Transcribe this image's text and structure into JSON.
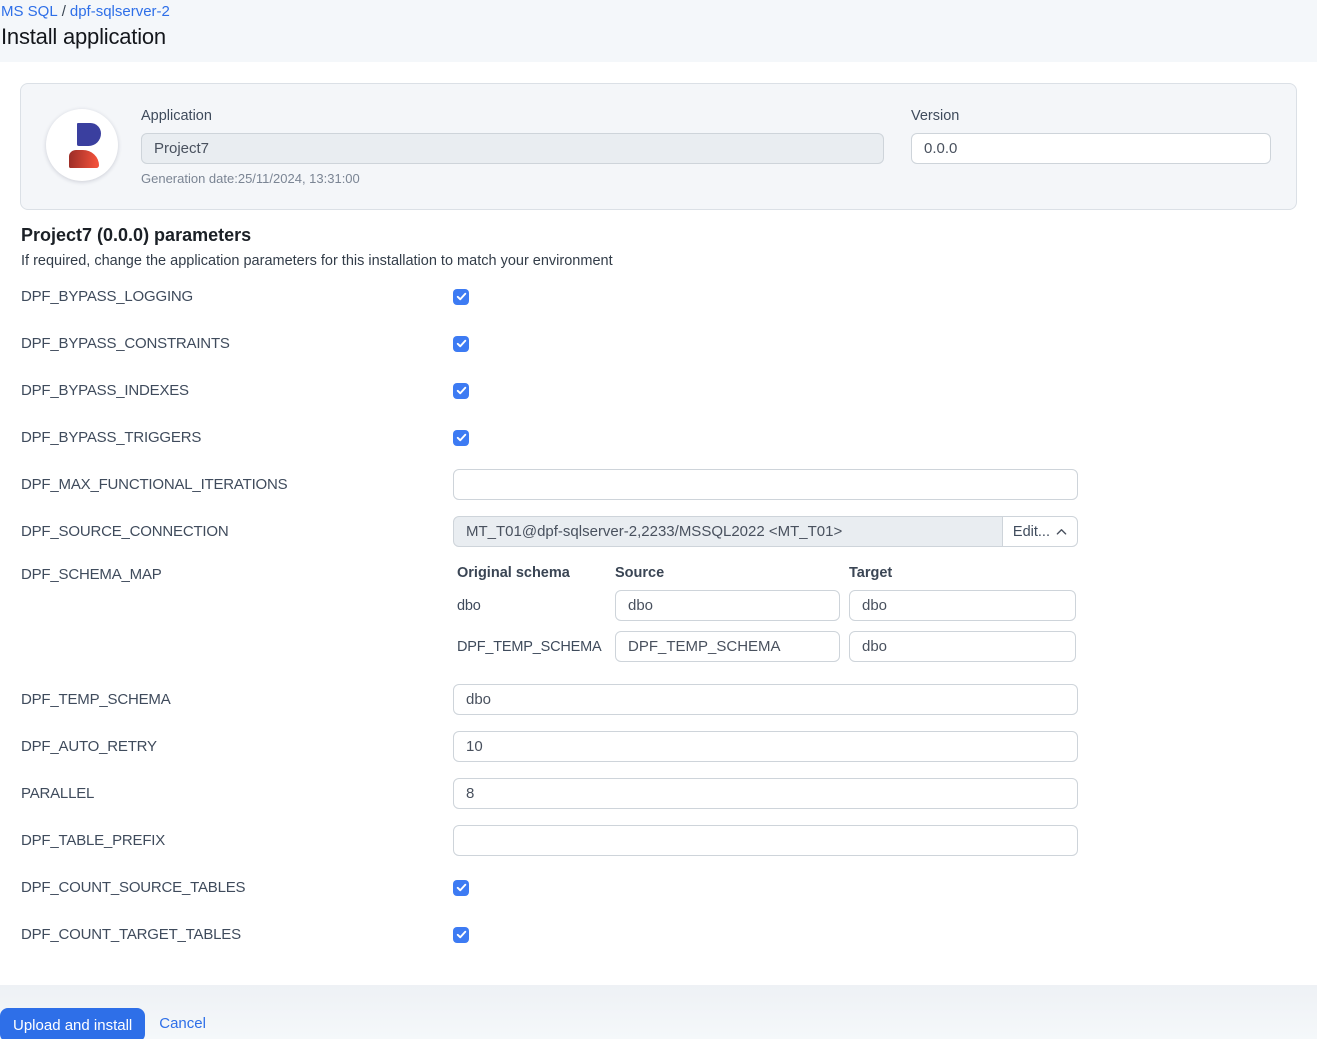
{
  "breadcrumb": {
    "items": [
      {
        "label": "MS SQL"
      },
      {
        "label": "dpf-sqlserver-2"
      }
    ],
    "separator": "/"
  },
  "page_title": "Install application",
  "app_card": {
    "application_label": "Application",
    "application_value": "Project7",
    "generation_date": "Generation date:25/11/2024, 13:31:00",
    "version_label": "Version",
    "version_value": "0.0.0"
  },
  "parameters": {
    "title": "Project7 (0.0.0) parameters",
    "subtitle": "If required, change the application parameters for this installation to match your environment",
    "rows": [
      {
        "type": "checkbox",
        "label": "DPF_BYPASS_LOGGING",
        "checked": true
      },
      {
        "type": "checkbox",
        "label": "DPF_BYPASS_CONSTRAINTS",
        "checked": true
      },
      {
        "type": "checkbox",
        "label": "DPF_BYPASS_INDEXES",
        "checked": true
      },
      {
        "type": "checkbox",
        "label": "DPF_BYPASS_TRIGGERS",
        "checked": true
      },
      {
        "type": "text",
        "label": "DPF_MAX_FUNCTIONAL_ITERATIONS",
        "value": ""
      },
      {
        "type": "connection",
        "label": "DPF_SOURCE_CONNECTION",
        "value": "MT_T01@dpf-sqlserver-2,2233/MSSQL2022 <MT_T01>",
        "button_label": "Edit...",
        "chevron": "up"
      },
      {
        "type": "schema_map",
        "label": "DPF_SCHEMA_MAP",
        "headers": [
          "Original schema",
          "Source",
          "Target"
        ],
        "map_rows": [
          {
            "original": "dbo",
            "source": "dbo",
            "target": "dbo"
          },
          {
            "original": "DPF_TEMP_SCHEMA",
            "source": "DPF_TEMP_SCHEMA",
            "target": "dbo"
          }
        ]
      },
      {
        "type": "text",
        "label": "DPF_TEMP_SCHEMA",
        "value": "dbo"
      },
      {
        "type": "text",
        "label": "DPF_AUTO_RETRY",
        "value": "10"
      },
      {
        "type": "text",
        "label": "PARALLEL",
        "value": "8"
      },
      {
        "type": "text",
        "label": "DPF_TABLE_PREFIX",
        "value": ""
      },
      {
        "type": "checkbox",
        "label": "DPF_COUNT_SOURCE_TABLES",
        "checked": true
      },
      {
        "type": "checkbox",
        "label": "DPF_COUNT_TARGET_TABLES",
        "checked": true
      }
    ]
  },
  "footer": {
    "install_label": "Upload and install",
    "cancel_label": "Cancel"
  },
  "colors": {
    "accent_blue": "#2e6fe8",
    "checkbox_blue": "#3d7bf3",
    "band_background": "#f4f7fa",
    "card_background": "#f4f6f9",
    "logo_indigo": "#3a3f9f",
    "logo_red": "#f0503a"
  }
}
